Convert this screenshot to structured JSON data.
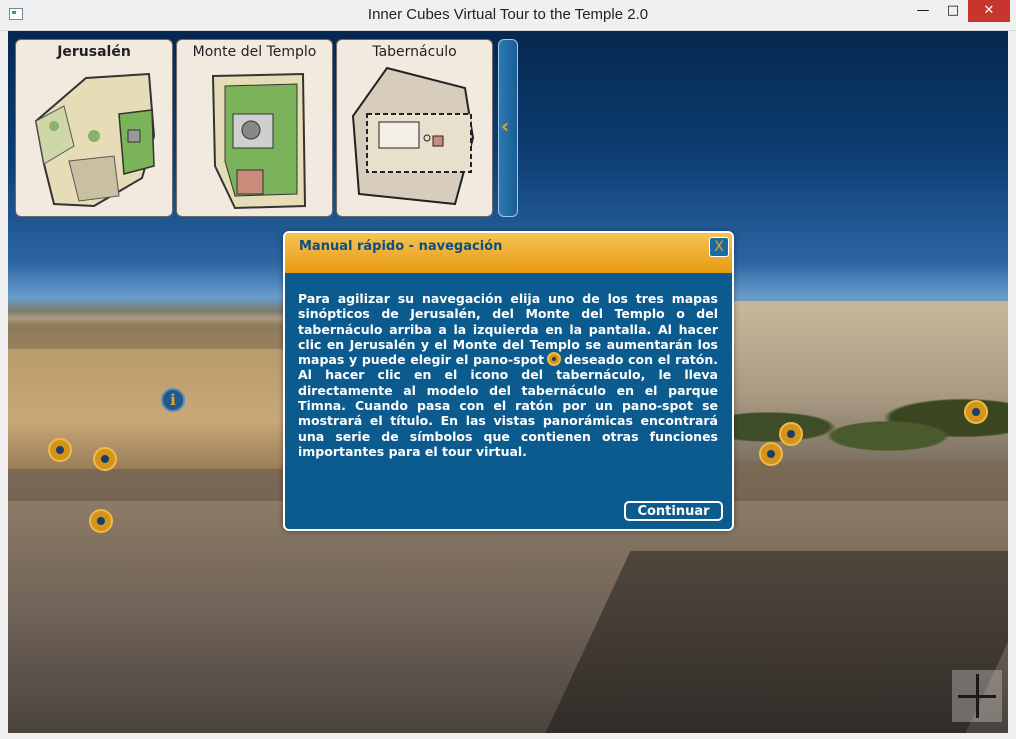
{
  "window": {
    "title": "Inner Cubes Virtual Tour to the Temple 2.0",
    "minimize_glyph": "—",
    "maximize_glyph": "□",
    "close_glyph": "✕"
  },
  "maps": [
    {
      "label": "Jerusalén",
      "selected": true
    },
    {
      "label": "Monte del Templo",
      "selected": false
    },
    {
      "label": "Tabernáculo",
      "selected": false
    }
  ],
  "panel_toggle": {
    "glyph": "‹"
  },
  "info_glyph": "i",
  "dialog": {
    "title": "Manual rápido - navegación",
    "close_glyph": "X",
    "body_before_icon": "Para agilizar su navegación elija uno de los tres mapas sinópticos de Jerusalén, del Monte del Templo o del tabernáculo arriba a la izquierda en la pantalla. Al hacer clic en Jerusalén y el Monte del Templo se aumentarán los mapas y puede elegir el pano-spot",
    "body_after_icon": "deseado con el ratón. Al hacer clic en el icono del tabernáculo, le lleva directamente al modelo del tabernáculo en el parque Timna. Cuando pasa con el ratón por un pano-spot se mostrará el título. En las vistas panorámicas encontrará una serie de símbolos que contienen otras funciones importantes para el tour virtual.",
    "button_label": "Continuar"
  },
  "colors": {
    "accent_orange": "#e79a10",
    "dialog_blue": "#0b5b8f",
    "title_text": "#0d4f80"
  }
}
